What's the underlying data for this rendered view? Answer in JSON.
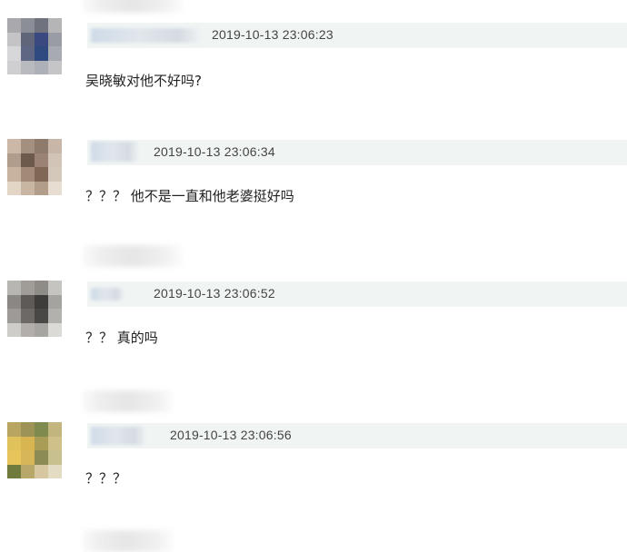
{
  "comments": [
    {
      "timestamp": "2019-10-13 23:06:23",
      "text": "吴晓敏对他不好吗?",
      "avatar": [
        "#a9a9ad",
        "#8c8e97",
        "#70737e",
        "#b5b5b8",
        "#c4c3c6",
        "#61657a",
        "#3a4a80",
        "#9a9ca5",
        "#d7d6d9",
        "#5f6684",
        "#2e4a7e",
        "#a8aab2",
        "#cfcfd2",
        "#b8bac0",
        "#aeb0b7",
        "#c5c5c8"
      ]
    },
    {
      "timestamp": "2019-10-13 23:06:34",
      "text": "？？？ 他不是一直和他老婆挺好吗",
      "avatar": [
        "#cbb8a7",
        "#a4907f",
        "#8e7b6c",
        "#c8b7a8",
        "#b19d8c",
        "#6e5a4d",
        "#9a8374",
        "#d2c4b6",
        "#c7b39f",
        "#a38a78",
        "#806857",
        "#d4c8ba",
        "#e3d6c6",
        "#c9b6a2",
        "#b29d8a",
        "#e7ddd0"
      ]
    },
    {
      "timestamp": "2019-10-13 23:06:52",
      "text": "？？ 真的吗",
      "avatar": [
        "#b7b6b3",
        "#a09d98",
        "#8f8c88",
        "#c6c4c1",
        "#8a8784",
        "#5d5a58",
        "#3f3d3c",
        "#a5a3a0",
        "#9d9a97",
        "#6c6966",
        "#4a4847",
        "#b3b1ae",
        "#cfcdca",
        "#b1aeab",
        "#a7a5a2",
        "#dcdad7"
      ]
    },
    {
      "timestamp": "2019-10-13 23:06:56",
      "text": "？？？",
      "avatar": [
        "#b8a562",
        "#9e9356",
        "#7f8a4f",
        "#c2b57e",
        "#e0c25a",
        "#d9b552",
        "#a99c57",
        "#cfc08a",
        "#e8c55a",
        "#d7b65a",
        "#8d8b55",
        "#c9c08f",
        "#6f7a3c",
        "#b7a86a",
        "#d6c7a0",
        "#e3dcc2"
      ]
    }
  ]
}
